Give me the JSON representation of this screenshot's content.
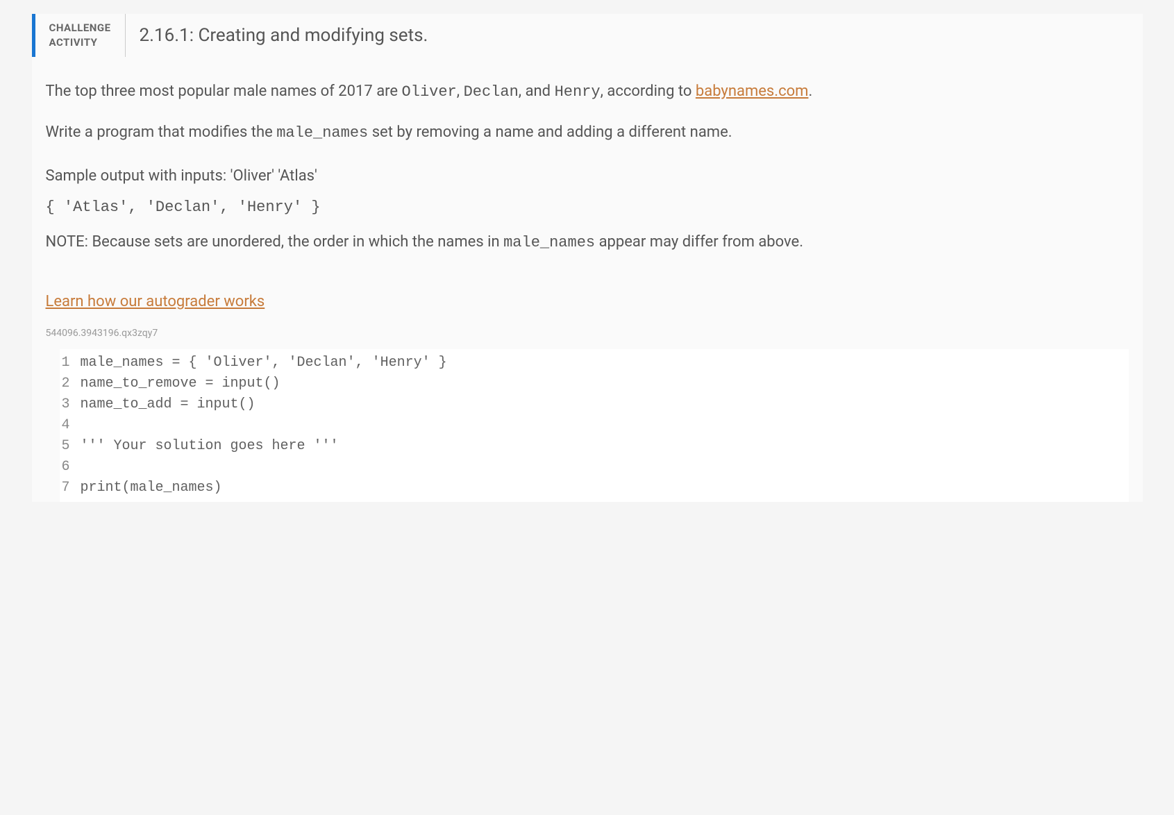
{
  "header": {
    "badge_line1": "CHALLENGE",
    "badge_line2": "ACTIVITY",
    "title": "2.16.1: Creating and modifying sets."
  },
  "description": {
    "para1_prefix": "The top three most popular male names of 2017 are ",
    "name1": "Oliver",
    "sep1": ", ",
    "name2": "Declan",
    "sep2": ", and ",
    "name3": "Henry",
    "para1_mid": ", according to ",
    "link_text": "babynames.com",
    "para1_suffix": ".",
    "para2_prefix": "Write a program that modifies the ",
    "varname": "male_names",
    "para2_suffix": " set by removing a name and adding a different name."
  },
  "sample": {
    "label": "Sample output with inputs: 'Oliver' 'Atlas'",
    "output": "{ 'Atlas', 'Declan', 'Henry' }"
  },
  "note": {
    "prefix": "NOTE: Because sets are unordered, the order in which the names in ",
    "varname": "male_names",
    "suffix": " appear may differ from above."
  },
  "autograder_link": "Learn how our autograder works",
  "file_id": "544096.3943196.qx3zqy7",
  "code": {
    "lines": [
      {
        "num": "1",
        "text": "male_names = { 'Oliver', 'Declan', 'Henry' }"
      },
      {
        "num": "2",
        "text": "name_to_remove = input()"
      },
      {
        "num": "3",
        "text": "name_to_add = input()"
      },
      {
        "num": "4",
        "text": ""
      },
      {
        "num": "5",
        "text": "''' Your solution goes here '''"
      },
      {
        "num": "6",
        "text": ""
      },
      {
        "num": "7",
        "text": "print(male_names)"
      }
    ]
  }
}
